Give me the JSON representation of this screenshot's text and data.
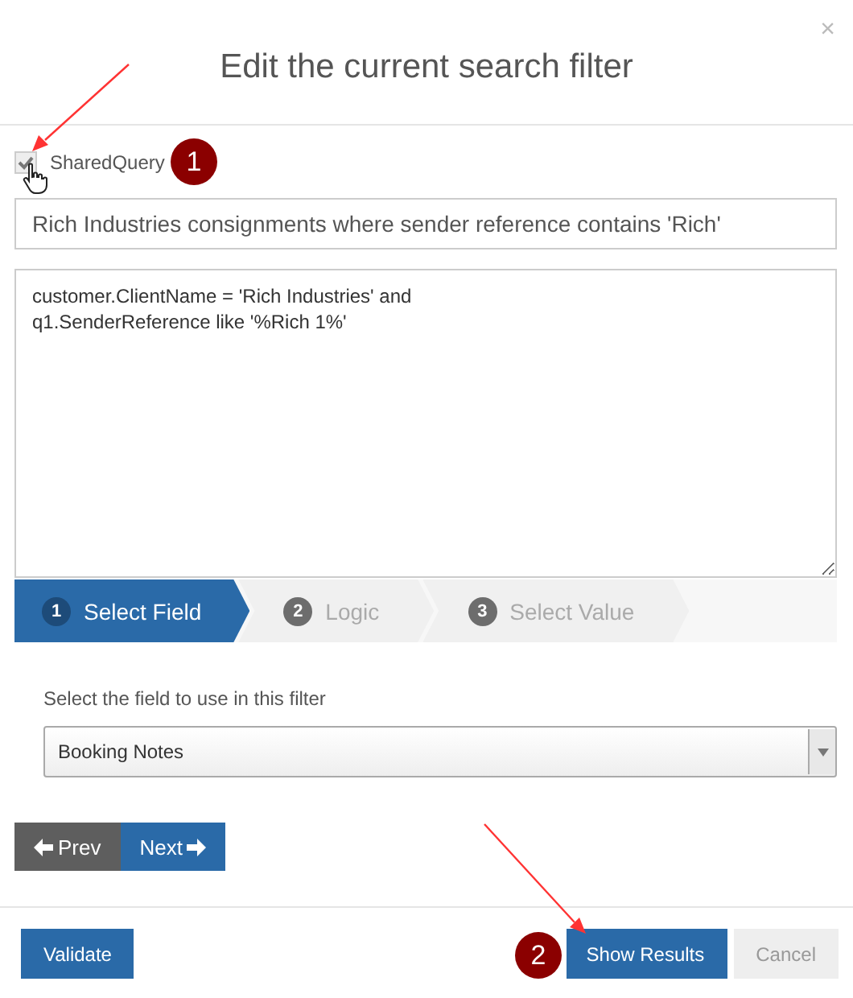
{
  "dialog": {
    "title": "Edit the current search filter",
    "close": "×"
  },
  "shared_query": {
    "label": "SharedQuery",
    "checked": true
  },
  "filter_name": {
    "value": "Rich Industries consignments where sender reference contains 'Rich'"
  },
  "query_text": {
    "value": "customer.ClientName = 'Rich Industries' and\nq1.SenderReference like '%Rich 1%'"
  },
  "steps": [
    {
      "number": "1",
      "label": "Select Field",
      "selected": true
    },
    {
      "number": "2",
      "label": "Logic",
      "selected": false
    },
    {
      "number": "3",
      "label": "Select Value",
      "selected": false
    }
  ],
  "field_prompt": "Select the field to use in this filter",
  "field_select": {
    "value": "Booking Notes"
  },
  "nav_buttons": [
    {
      "label": "Prev",
      "kind": "prev"
    },
    {
      "label": "Next",
      "kind": "next"
    }
  ],
  "footer": {
    "validate": "Validate",
    "show_results": "Show Results",
    "cancel": "Cancel"
  },
  "callouts": [
    {
      "number": "1"
    },
    {
      "number": "2"
    }
  ]
}
